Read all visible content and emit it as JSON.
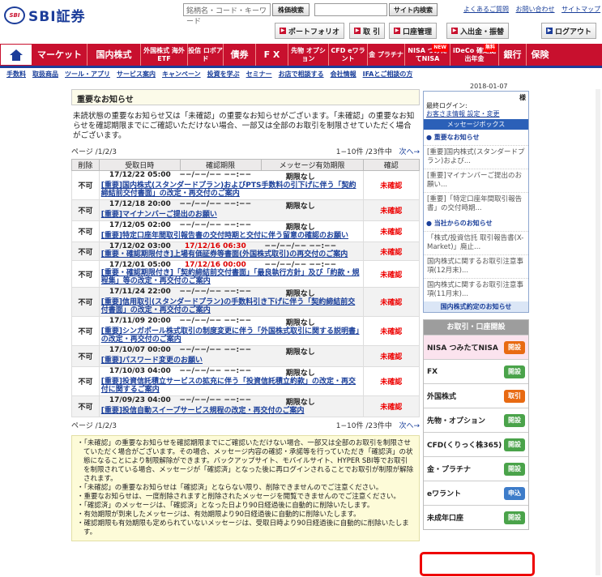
{
  "header": {
    "logo_mark": "SBI",
    "logo_name": "SBI証券",
    "search_placeholder": "銘柄名・コード・キーワード",
    "stock_search_label": "株価検索",
    "site_search_label": "サイト内検索",
    "links": [
      "よくあるご質問",
      "お問い合わせ",
      "サイトマップ"
    ],
    "buttons": [
      "ポートフォリオ",
      "取 引",
      "口座管理",
      "入出金・振替"
    ],
    "logout": "ログアウト"
  },
  "nav": {
    "items": [
      "マーケット",
      "国内株式",
      "外国株式 海外ETF",
      "投信 ロボアド",
      "債券",
      "F X",
      "先物 オプション",
      "CFD eワラント",
      "金 プラチナ",
      "NISA つみたてNISA",
      "iDeCo 確定拠出年金",
      "銀行",
      "保険"
    ],
    "badges": {
      "nisa": "NEW",
      "ideco": "無料"
    }
  },
  "subnav": [
    "手数料",
    "取扱商品",
    "ツール・アプリ",
    "サービス案内",
    "キャンペーン",
    "投資を学ぶ",
    "セミナー",
    "お店で相談する",
    "会社情報",
    "IFAとご相談の方"
  ],
  "date": "2018-01-07",
  "main": {
    "title": "重要なお知らせ",
    "intro": "未読状態の重要なお知らせ又は「未確認」の重要なお知らせがございます。「未確認」の重要なお知らせを確認期限までにご確認いただけない場合、一部又は全部のお取引を制限させていただく場合がございます。",
    "page_top": "ページ /1/2/3",
    "count_top": "1−10件 /23件中",
    "next": "次へ→",
    "headers": [
      "削除",
      "受取日時",
      "確認期限",
      "メッセージ有効期限",
      "確認"
    ],
    "rows": [
      {
        "del": "不可",
        "date": "17/12/22 05:00",
        "deadline": "−−/−−/−− −−:−−",
        "expire": "期限なし",
        "subject": "[重要]国内株式(スタンダードプラン)およびPTS手数料の引下げに伴う「契約締結前交付書面」の改定・再交付のご案内",
        "status": "未確認",
        "red": false
      },
      {
        "del": "不可",
        "date": "17/12/18 20:00",
        "deadline": "−−/−−/−− −−:−−",
        "expire": "期限なし",
        "subject": "[重要]マイナンバーご提出のお願い",
        "status": "未確認",
        "red": false
      },
      {
        "del": "不可",
        "date": "17/12/05 02:00",
        "deadline": "−−/−−/−− −−:−−",
        "expire": "期限なし",
        "subject": "[重要]特定口座年間取引報告書の交付時期と交付に伴う留意の確認のお願い",
        "status": "未確認",
        "red": false
      },
      {
        "del": "不可",
        "date": "17/12/02 03:00",
        "deadline": "17/12/16 06:30",
        "expire": "−−/−−/−− −−:−−",
        "subject": "[重要・確認期限付き]上場有価証券等書面(外国株式取引)の再交付のご案内",
        "status": "未確認",
        "red": true
      },
      {
        "del": "不可",
        "date": "17/12/01 05:00",
        "deadline": "17/12/16 00:00",
        "expire": "−−/−−/−− −−:−−",
        "subject": "[重要・確認期限付き]「契約締結前交付書面」「最良執行方針」及び「約款・規程集」等の改定・再交付のご案内",
        "status": "未確認",
        "red": true
      },
      {
        "del": "不可",
        "date": "17/11/24 22:00",
        "deadline": "−−/−−/−− −−:−−",
        "expire": "期限なし",
        "subject": "[重要]信用取引(スタンダードプラン)の手数料引き下げに伴う「契約締結前交付書面」の改定・再交付のご案内",
        "status": "未確認",
        "red": false
      },
      {
        "del": "不可",
        "date": "17/11/09 20:00",
        "deadline": "−−/−−/−− −−:−−",
        "expire": "期限なし",
        "subject": "[重要]シンガポール株式取引の制度変更に伴う「外国株式取引に関する説明書」の改定・再交付のご案内",
        "status": "未確認",
        "red": false
      },
      {
        "del": "不可",
        "date": "17/10/07 00:00",
        "deadline": "−−/−−/−− −−:−−",
        "expire": "期限なし",
        "subject": "[重要]パスワード変更のお願い",
        "status": "未確認",
        "red": false
      },
      {
        "del": "不可",
        "date": "17/10/03 04:00",
        "deadline": "−−/−−/−− −−:−−",
        "expire": "期限なし",
        "subject": "[重要]投資信託積立サービスの拡充に伴う「投資信託積立約款」の改定・再交付に関するご案内",
        "status": "未確認",
        "red": false
      },
      {
        "del": "不可",
        "date": "17/09/23 04:00",
        "deadline": "−−/−−/−− −−:−−",
        "expire": "期限なし",
        "subject": "[重要]投信自動スイープサービス規程の改定・再交付のご案内",
        "status": "未確認",
        "red": false
      }
    ],
    "page_bottom": "ページ /1/2/3",
    "count_bottom": "1−10件 /23件中",
    "notes": [
      "・「未確認」の重要なお知らせを確認期限までにご確認いただけない場合、一部又は全部のお取引を制限させていただく場合がございます。その場合、メッセージ内容の確認・承諾等を行っていただき「確認済」の状態になることにより制限解除ができます。バックアップサイト、モバイルサイト、HYPER SBI等でお取引を制限されている場合、メッセージが「確認済」となった後に再ログインされることでお取引が制限が解除されます。",
      "・「未確認」の重要なお知らせは「確認済」とならない限り、削除できませんのでご注意ください。",
      "・重要なお知らせは、一度削除されますと削除されたメッセージを閲覧できませんのでご注意ください。",
      "・「確認済」のメッセージは、「確認済」となった日より90日経過後に自動的に削除いたします。",
      "・有効期限が到来したメッセージは、有効期限より90日経過後に自動的に削除いたします。",
      "・確認期限も有効期限も定められていないメッセージは、受取日時より90日経過後に自動的に削除いたします。"
    ]
  },
  "side": {
    "name_suffix": "様",
    "last_login_label": "最終ログイン:",
    "customer_info": "お客さま情報 設定・変更",
    "msgbox": "メッセージボックス",
    "important_label": "重要なお知らせ",
    "important": [
      "[重要]国内株式(スタンダードプラン)および...",
      "[重要]マイナンバーご提出のお願い...",
      "[重要]「特定口座年間取引報告書」の交付時期..."
    ],
    "from_us_label": "当社からのお知らせ",
    "from_us": [
      "「株式/投資信託 取引報告書(X-Market)」廃止...",
      "国内株式に関するお取引注意事項(12月末)...",
      "国内株式に関するお取引注意事項(11月末)..."
    ],
    "domestic_label": "国内株式約定のお知らせ",
    "acc_head": "お取引・口座開設",
    "acc": [
      {
        "label": "NISA つみたてNISA",
        "btn": "開設",
        "color": "or"
      },
      {
        "label": "FX",
        "btn": "開設",
        "color": "gr"
      },
      {
        "label": "外国株式",
        "btn": "取引",
        "color": "or"
      },
      {
        "label": "先物・オプション",
        "btn": "開設",
        "color": "gr"
      },
      {
        "label": "CFD(くりっく株365)",
        "btn": "開設",
        "color": "gr"
      },
      {
        "label": "金・プラチナ",
        "btn": "開設",
        "color": "gr"
      },
      {
        "label": "eワラント",
        "btn": "申込",
        "color": "bl"
      },
      {
        "label": "未成年口座",
        "btn": "開設",
        "color": "gr"
      }
    ]
  }
}
